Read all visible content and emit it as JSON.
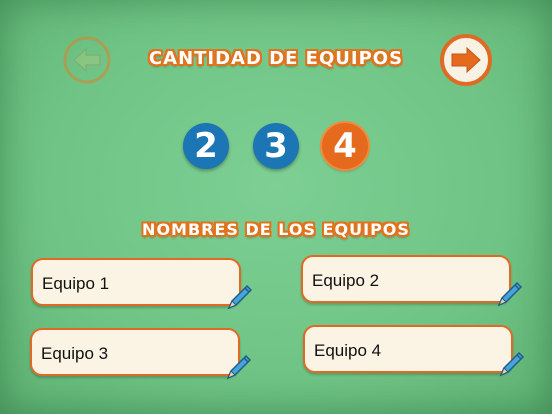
{
  "header": {
    "title": "CANTIDAD DE EQUIPOS"
  },
  "nav": {
    "back_icon": "arrow-left-icon",
    "next_icon": "arrow-right-icon"
  },
  "counts": {
    "options": [
      "2",
      "3",
      "4"
    ],
    "selected": "4"
  },
  "names": {
    "title": "NOMBRES DE LOS EQUIPOS",
    "teams": [
      "Equipo 1",
      "Equipo 2",
      "Equipo 3",
      "Equipo 4"
    ],
    "edit_icon": "pencil-icon"
  },
  "colors": {
    "background": "#6fc485",
    "accent": "#e66a1d",
    "blue": "#1c75b4",
    "field": "#fbf3e3"
  }
}
